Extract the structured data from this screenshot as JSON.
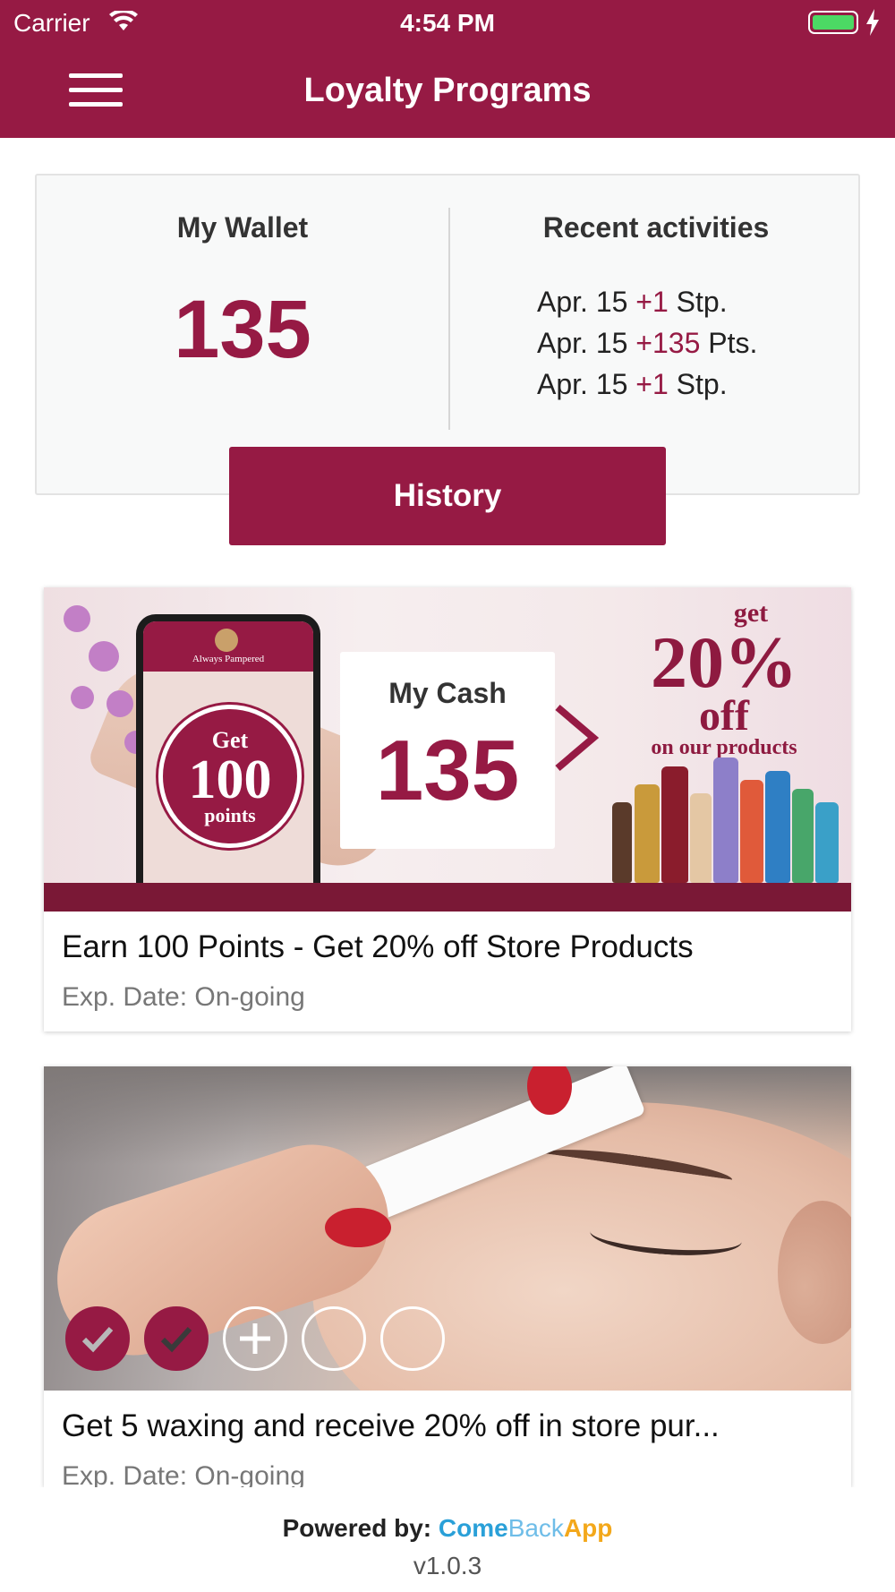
{
  "status_bar": {
    "carrier": "Carrier",
    "time": "4:54 PM",
    "battery_level": 1.0
  },
  "nav": {
    "title": "Loyalty Programs",
    "menu_icon": "hamburger-menu-icon"
  },
  "wallet": {
    "title": "My Wallet",
    "value": "135",
    "recent_title": "Recent activities",
    "activities": [
      {
        "date": "Apr. 15",
        "amount": "+1",
        "unit": "Stp."
      },
      {
        "date": "Apr. 15",
        "amount": "+135",
        "unit": "Pts."
      },
      {
        "date": "Apr. 15",
        "amount": "+1",
        "unit": "Stp."
      }
    ],
    "history_label": "History"
  },
  "offers": [
    {
      "title": "Earn 100 Points - Get 20% off Store Products",
      "exp": "Exp. Date: On-going",
      "banner": {
        "brand": "Always Pampered",
        "get_top": "Get",
        "get_mid": "100",
        "get_bot": "points",
        "cash_label": "My Cash",
        "cash_value": "135",
        "promo_get": "get",
        "promo_pct": "20%",
        "promo_off": "off",
        "promo_tail": "on our products"
      }
    },
    {
      "title": "Get 5 waxing and receive 20% off in store pur...",
      "exp": "Exp. Date: On-going",
      "stamps": {
        "total": 5,
        "completed": 2
      }
    }
  ],
  "footer": {
    "powered_label": "Powered by:",
    "brand_part1": "Come",
    "brand_part2": "Back",
    "brand_part3": "App",
    "version": "v1.0.3"
  },
  "colors": {
    "brand": "#961a44",
    "battery": "#4cd964"
  }
}
